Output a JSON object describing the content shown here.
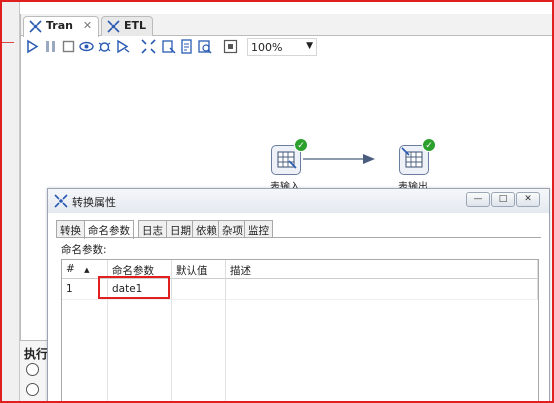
{
  "tabs": [
    {
      "label": "Tran",
      "close": "✕",
      "active": true
    },
    {
      "label": "ETL",
      "active": false
    }
  ],
  "toolbar": {
    "zoom_value": "100%"
  },
  "steps": [
    {
      "label": "表输入"
    },
    {
      "label": "表输出"
    }
  ],
  "left_bottom": {
    "title": "执行"
  },
  "dialog": {
    "title": "转换属性",
    "minimize": "—",
    "maximize": "□",
    "close": "✕",
    "tabs": [
      "转换",
      "命名参数",
      "日志",
      "日期",
      "依赖",
      "杂项",
      "监控"
    ],
    "active_tab": "命名参数",
    "section_label": "命名参数:",
    "columns": [
      "#",
      "命名参数",
      "默认值",
      "描述"
    ],
    "rows": [
      {
        "num": "1",
        "name": "date1",
        "default": "",
        "desc": ""
      }
    ]
  },
  "colors": {
    "highlight": "#e02020",
    "accent": "#2a5bb3",
    "success": "#2ca02c"
  }
}
